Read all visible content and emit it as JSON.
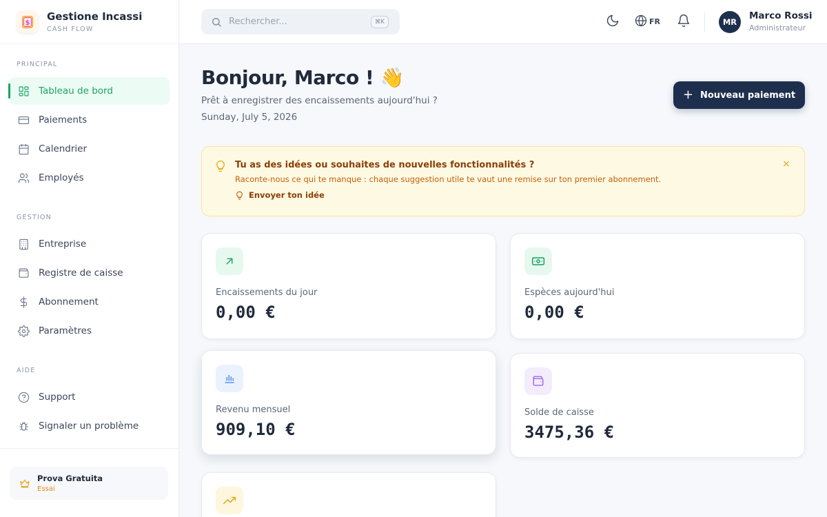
{
  "brand": {
    "title": "Gestione Incassi",
    "subtitle": "CASH FLOW"
  },
  "sidebar": {
    "sections": [
      {
        "title": "PRINCIPAL"
      },
      {
        "title": "GESTION"
      },
      {
        "title": "AIDE"
      }
    ],
    "items": [
      {
        "label": "Tableau de bord",
        "icon": "dashboard-icon",
        "active": true
      },
      {
        "label": "Paiements",
        "icon": "credit-card-icon"
      },
      {
        "label": "Calendrier",
        "icon": "calendar-icon"
      },
      {
        "label": "Employés",
        "icon": "users-icon"
      },
      {
        "label": "Entreprise",
        "icon": "building-icon"
      },
      {
        "label": "Registre de caisse",
        "icon": "wallet-icon"
      },
      {
        "label": "Abonnement",
        "icon": "dollar-icon"
      },
      {
        "label": "Paramètres",
        "icon": "gear-icon"
      },
      {
        "label": "Support",
        "icon": "help-circle-icon"
      },
      {
        "label": "Signaler un problème",
        "icon": "bug-icon"
      }
    ],
    "trial": {
      "title": "Prova Gratuita",
      "subtitle": "Essai"
    }
  },
  "topbar": {
    "search": {
      "placeholder": "Rechercher...",
      "value": "",
      "shortcut": "⌘K"
    },
    "language": "FR",
    "user": {
      "initials": "MR",
      "name": "Marco Rossi",
      "role": "Administrateur"
    }
  },
  "main": {
    "greeting": "Bonjour, Marco ! 👋",
    "subtitle": "Prêt à enregistrer des encaissements aujourd'hui ?",
    "date": "Sunday, July 5, 2026",
    "new_payment_label": "Nouveau paiement",
    "banner": {
      "title": "Tu as des idées ou souhaites de nouvelles fonctionnalités ?",
      "text": "Raconte-nous ce qui te manque : chaque suggestion utile te vaut une remise sur ton premier abonnement.",
      "link": "Envoyer ton idée",
      "close": "×"
    },
    "cards": [
      {
        "label": "Encaissements du jour",
        "value": "0,00 €",
        "icon": "arrow-up-right-icon",
        "color": "#16a05d",
        "bg": "#e7f8ef"
      },
      {
        "label": "Espèces aujourd'hui",
        "value": "0,00 €",
        "icon": "cash-icon",
        "color": "#16a05d",
        "bg": "#e7f8ef"
      },
      {
        "label": "Revenu mensuel",
        "value": "909,10 €",
        "icon": "bar-chart-icon",
        "color": "#3b82f6",
        "bg": "#eaf2fe"
      },
      {
        "label": "Solde de caisse",
        "value": "3475,36 €",
        "icon": "wallet-icon",
        "color": "#9b5de5",
        "bg": "#f3ecfd"
      },
      {
        "label": "",
        "value": "",
        "icon": "trending-up-icon",
        "color": "#e0a10b",
        "bg": "#fef6dd"
      }
    ]
  },
  "colors": {
    "accent": "#1aa563",
    "primary": "#1e2f4e",
    "warning": "#c2600b"
  }
}
